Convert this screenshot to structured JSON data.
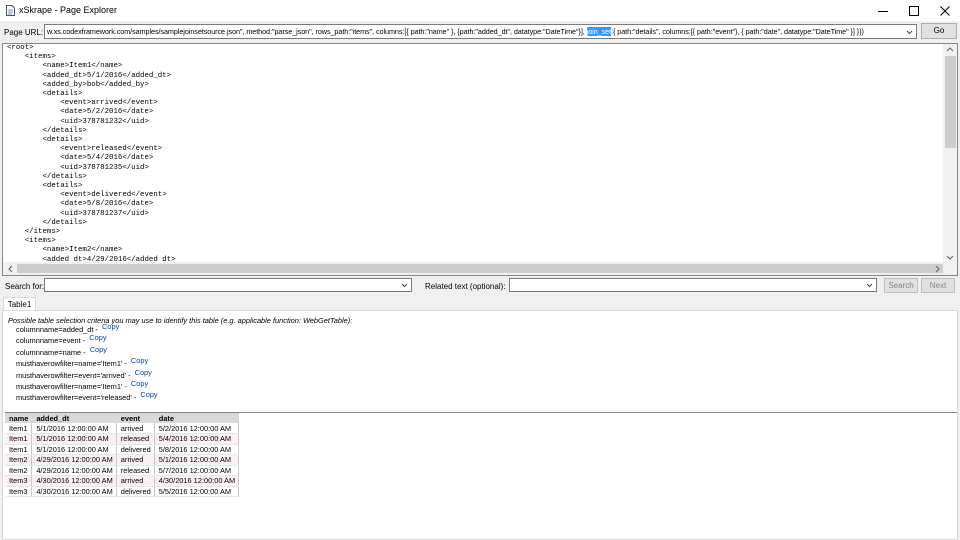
{
  "window": {
    "title": "xSkrape - Page Explorer",
    "buttons": {
      "minimize": "minimize-icon",
      "maximize": "maximize-icon",
      "close": "close-icon"
    }
  },
  "url_bar": {
    "label": "Page URL:",
    "value_before": "w.xs.codexframework.com/samples/samplejoinsetsource.json\", method:\"parse_json\", rows_path:\"items\", columns:[{ path:\"name\" }, {path:\"added_dt\", datatype:\"DateTime\"}], ",
    "value_selected": "join_set",
    "value_after": ":{ path:\"details\", columns:[{ path:\"event\"}, { path:\"date\", datatype:\"DateTime\" }] }})",
    "go_label": "Go"
  },
  "xml_lines": [
    "<root>",
    "    <items>",
    "        <name>Item1</name>",
    "        <added_dt>5/1/2016</added_dt>",
    "        <added_by>bob</added_by>",
    "        <details>",
    "            <event>arrived</event>",
    "            <date>5/2/2016</date>",
    "            <uid>378781232</uid>",
    "        </details>",
    "        <details>",
    "            <event>released</event>",
    "            <date>5/4/2016</date>",
    "            <uid>378781235</uid>",
    "        </details>",
    "        <details>",
    "            <event>delivered</event>",
    "            <date>5/8/2016</date>",
    "            <uid>378781237</uid>",
    "        </details>",
    "    </items>",
    "    <items>",
    "        <name>Item2</name>",
    "        <added dt>4/29/2016</added dt>"
  ],
  "search": {
    "label": "Search for:",
    "related_label": "Related text (optional):",
    "search_button": "Search",
    "next_button": "Next"
  },
  "tabs": [
    {
      "label": "Table1"
    }
  ],
  "hint": "Possible table selection criteria you may use to identify this table (e.g. applicable function: WebGetTable):",
  "criteria": [
    {
      "text": "columnname=added_dt - ",
      "copy": "Copy"
    },
    {
      "text": "columnname=event - ",
      "copy": "Copy"
    },
    {
      "text": "columnname=name - ",
      "copy": "Copy"
    },
    {
      "text": "musthaverowfilter=name='Item1' - ",
      "copy": "Copy"
    },
    {
      "text": "musthaverowfilter=event='arrived' - ",
      "copy": "Copy"
    },
    {
      "text": "musthaverowfilter=name='Item1' - ",
      "copy": "Copy"
    },
    {
      "text": "musthaverowfilter=event='released' - ",
      "copy": "Copy"
    }
  ],
  "table": {
    "headers": [
      "name",
      "added_dt",
      "event",
      "date"
    ],
    "rows": [
      [
        "Item1",
        "5/1/2016 12:00:00 AM",
        "arrived",
        "5/2/2016 12:00:00 AM"
      ],
      [
        "Item1",
        "5/1/2016 12:00:00 AM",
        "released",
        "5/4/2016 12:00:00 AM"
      ],
      [
        "Item1",
        "5/1/2016 12:00:00 AM",
        "delivered",
        "5/8/2016 12:00:00 AM"
      ],
      [
        "Item2",
        "4/29/2016 12:00:00 AM",
        "arrived",
        "5/1/2016 12:00:00 AM"
      ],
      [
        "Item2",
        "4/29/2016 12:00:00 AM",
        "released",
        "5/7/2016 12:00:00 AM"
      ],
      [
        "Item3",
        "4/30/2016 12:00:00 AM",
        "arrived",
        "4/30/2016 12:00:00 AM"
      ],
      [
        "Item3",
        "4/30/2016 12:00:00 AM",
        "delivered",
        "5/5/2016 12:00:00 AM"
      ]
    ]
  }
}
